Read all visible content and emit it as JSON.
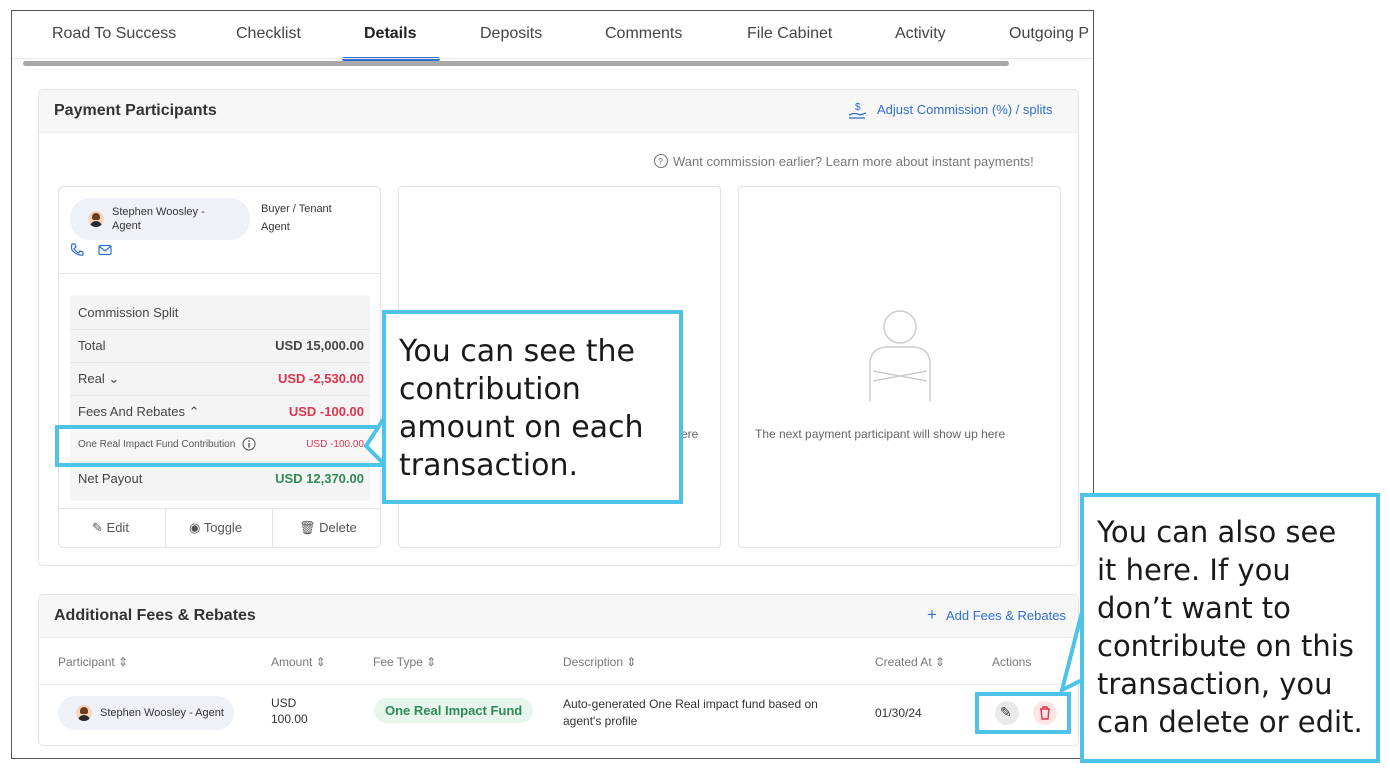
{
  "tabs": [
    "Road To Success",
    "Checklist",
    "Details",
    "Deposits",
    "Comments",
    "File Cabinet",
    "Activity",
    "Outgoing P"
  ],
  "active_tab": "Details",
  "payment_participants": {
    "title": "Payment Participants",
    "adjust_link": "Adjust Commission (%) / splits",
    "instant_hint": "Want commission earlier? Learn more about instant payments!",
    "participant": {
      "name_line1": "Stephen Woosley -",
      "name_line2": "Agent",
      "role_line1": "Buyer / Tenant",
      "role_line2": "Agent"
    },
    "split": {
      "header": "Commission Split",
      "total_label": "Total",
      "total_value": "USD 15,000.00",
      "real_label": "Real",
      "real_value": "USD -2,530.00",
      "fees_label": "Fees And Rebates",
      "fees_value": "USD -100.00",
      "fund_label": "One Real Impact Fund Contribution",
      "fund_value": "USD -100.00",
      "net_label": "Net Payout",
      "net_value": "USD 12,370.00"
    },
    "actions": {
      "edit": "Edit",
      "toggle": "Toggle",
      "delete": "Delete"
    },
    "empty_partial": "ere",
    "empty_text": "The next payment participant will show up here"
  },
  "fees": {
    "title": "Additional Fees & Rebates",
    "add_link": "Add Fees & Rebates",
    "columns": [
      "Participant",
      "Amount",
      "Fee Type",
      "Description",
      "Created At",
      "Actions"
    ],
    "row": {
      "participant": "Stephen Woosley - Agent",
      "amount_line1": "USD",
      "amount_line2": "100.00",
      "fee_type": "One Real Impact Fund",
      "description_line1": "Auto-generated One Real impact fund based on",
      "description_line2": "agent's profile",
      "created_at": "01/30/24"
    }
  },
  "callouts": {
    "first": [
      "You can see the",
      "contribution",
      "amount on each",
      "transaction."
    ],
    "second": [
      "You can also see",
      "it here. If you",
      "don’t want to",
      "contribute on this",
      "transaction, you",
      "can delete or edit."
    ]
  },
  "colors": {
    "accent": "#2f6fd0",
    "callout": "#4dc3e8",
    "negative": "#e0344e",
    "positive": "#2e8a57"
  }
}
